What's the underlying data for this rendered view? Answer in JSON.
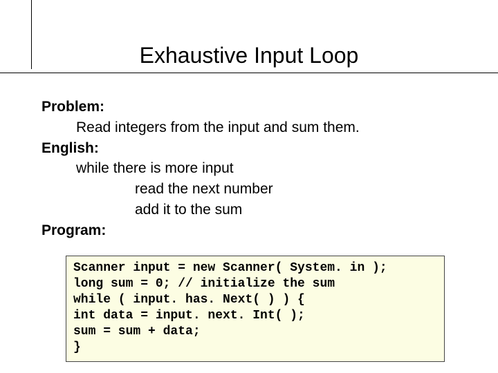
{
  "title": "Exhaustive Input Loop",
  "labels": {
    "problem": "Problem:",
    "english": "English:",
    "program": "Program:"
  },
  "problem_text": "Read integers from the input and sum them.",
  "english_lines": {
    "l1": "while there is more input",
    "l2": "read the next number",
    "l3": "add it to the sum"
  },
  "code_lines": {
    "c1": "Scanner input = new Scanner( System. in );",
    "c2": "long sum = 0; // initialize the sum",
    "c3": "while ( input. has. Next( ) ) {",
    "c4": "int data = input. next. Int( );",
    "c5": "sum = sum + data;",
    "c6": "}"
  }
}
